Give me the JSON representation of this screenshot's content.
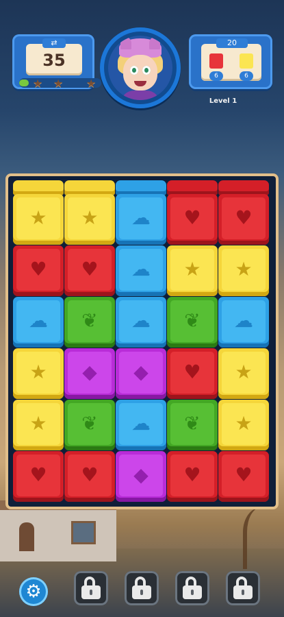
{
  "hud": {
    "moves": "35",
    "moves_progress": 0.12,
    "stars_earned": 0,
    "stars_total": 3,
    "goal_total": "20",
    "goals": [
      {
        "color": "red",
        "hex": "#e7343a",
        "count": "6"
      },
      {
        "color": "yellow",
        "hex": "#fbe552",
        "count": "6"
      }
    ],
    "level_label": "Level 1"
  },
  "board": {
    "columns": 5,
    "rows": 6,
    "partial_top_row": [
      "yellow",
      "yellow",
      "blue",
      "red",
      "red"
    ],
    "grid": [
      [
        "yellow",
        "yellow",
        "blue",
        "red",
        "red"
      ],
      [
        "red",
        "red",
        "blue",
        "yellow",
        "yellow"
      ],
      [
        "blue",
        "green",
        "blue",
        "green",
        "blue"
      ],
      [
        "yellow",
        "purple",
        "purple",
        "red",
        "yellow"
      ],
      [
        "yellow",
        "green",
        "blue",
        "green",
        "yellow"
      ],
      [
        "red",
        "red",
        "purple",
        "red",
        "red"
      ]
    ],
    "symbols": {
      "yellow": "★",
      "red": "♥",
      "blue": "☁",
      "green": "❦",
      "purple": "◆"
    }
  },
  "toolbar": {
    "settings_icon": "gear-icon",
    "locked_boosters": 4,
    "lock_icon": "lock-icon"
  }
}
